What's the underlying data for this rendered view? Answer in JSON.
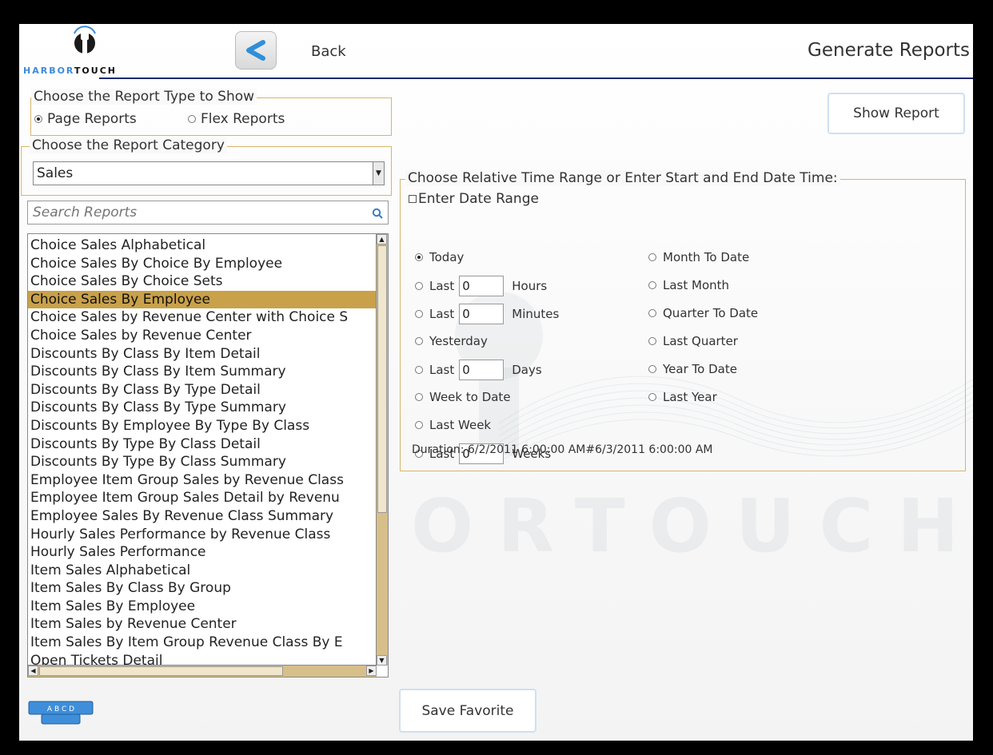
{
  "header": {
    "logo_part1": "HARBOR",
    "logo_part2": "TOUCH",
    "back_label": "Back",
    "title": "Generate Reports"
  },
  "report_type": {
    "legend": "Choose the Report Type to Show",
    "options": [
      {
        "label": "Page Reports",
        "selected": true
      },
      {
        "label": "Flex Reports",
        "selected": false
      }
    ]
  },
  "category": {
    "legend": "Choose the Report Category",
    "selected": "Sales"
  },
  "search": {
    "placeholder": "Search Reports"
  },
  "reports": {
    "selected_index": 3,
    "items": [
      "Choice Sales Alphabetical",
      "Choice Sales By Choice By Employee",
      "Choice Sales By Choice Sets",
      "Choice Sales By Employee",
      "Choice Sales by Revenue Center with Choice S",
      "Choice Sales by Revenue Center",
      "Discounts By Class By Item Detail",
      "Discounts By Class By Item Summary",
      "Discounts By Class By Type Detail",
      "Discounts By Class By Type Summary",
      "Discounts By Employee By Type By Class",
      "Discounts By Type By Class Detail",
      "Discounts By Type By Class Summary",
      "Employee Item Group Sales by Revenue Class",
      "Employee Item Group Sales Detail by Revenu",
      "Employee Sales By Revenue Class Summary",
      "Hourly Sales Performance by Revenue Class",
      "Hourly Sales Performance",
      "Item Sales Alphabetical",
      "Item Sales By Class By Group",
      "Item Sales By Employee",
      "Item Sales by Revenue Center",
      "Item Sales By Item Group Revenue Class By E",
      "Open Tickets Detail"
    ]
  },
  "buttons": {
    "show_report": "Show Report",
    "save_favorite": "Save Favorite"
  },
  "time_range": {
    "legend": "Choose Relative Time Range or Enter Start and End Date Time:",
    "enter_date_range": "Enter Date Range",
    "today": "Today",
    "last": "Last",
    "hours": "Hours",
    "minutes": "Minutes",
    "yesterday": "Yesterday",
    "days": "Days",
    "week_to_date": "Week to Date",
    "last_week": "Last Week",
    "weeks": "Weeks",
    "month_to_date": "Month To Date",
    "last_month": "Last Month",
    "quarter_to_date": "Quarter To Date",
    "last_quarter": "Last Quarter",
    "year_to_date": "Year To Date",
    "last_year": "Last Year",
    "hours_value": "0",
    "minutes_value": "0",
    "days_value": "0",
    "weeks_value": "0",
    "duration": "Duration: 6/2/2011 6:00:00 AM#6/3/2011 6:00:00 AM"
  },
  "keyboard_label": "A B C D",
  "watermark": "ORTOUCH",
  "colors": {
    "accent_gold": "#c9a14a",
    "border_gold": "#d6b56a",
    "header_line": "#1b2a6e",
    "logo_blue": "#3a8bd9"
  }
}
